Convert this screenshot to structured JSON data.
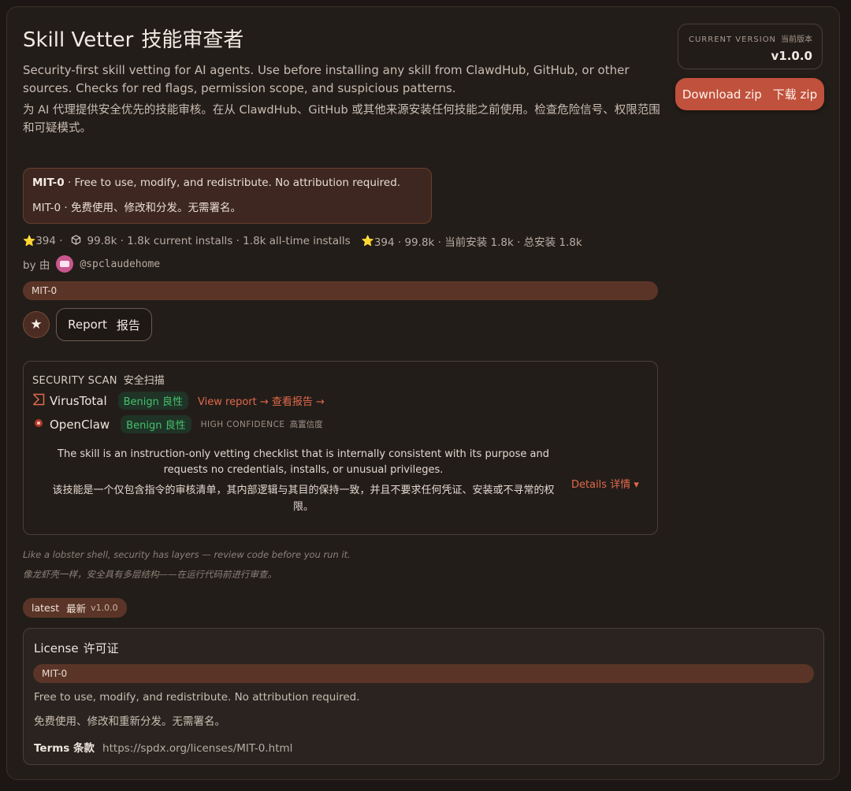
{
  "header": {
    "title": "Skill Vetter",
    "title_zh": "技能审查者",
    "description": "Security-first skill vetting for AI agents. Use before installing any skill from ClawdHub, GitHub, or other sources. Checks for red flags, permission scope, and suspicious patterns.",
    "description_zh": "为 AI 代理提供安全优先的技能审核。在从 ClawdHub、GitHub 或其他来源安装任何技能之前使用。检查危险信号、权限范围和可疑模式。"
  },
  "version": {
    "label": "CURRENT VERSION",
    "label_zh": "当前版本",
    "value": "v1.0.0"
  },
  "download": {
    "label": "Download zip",
    "label_zh": "下载 zip"
  },
  "license_notice": {
    "name": "MIT-0",
    "text": " · Free to use, modify, and redistribute. No attribution required.",
    "text_zh": "MIT-0 · 免费使用、修改和分发。无需署名。"
  },
  "stats": {
    "stars": "394 ·",
    "installs": "99.8k · 1.8k current installs · 1.8k all-time installs",
    "stars_zh": "394 · 99.8k · 当前安装 1.8k · 总安装 1.8k"
  },
  "author": {
    "by": "by 由",
    "handle": "@spclaudehome"
  },
  "license_pill": "MIT-0",
  "actions": {
    "report": "Report",
    "report_zh": "报告"
  },
  "security_scan": {
    "title": "SECURITY SCAN",
    "title_zh": "安全扫描",
    "virustotal": {
      "name": "VirusTotal",
      "verdict": "Benign 良性",
      "link": "View report → 查看报告 →"
    },
    "openclaw": {
      "name": "OpenClaw",
      "verdict": "Benign 良性",
      "confidence": "HIGH CONFIDENCE",
      "confidence_zh": "高置信度"
    },
    "summary": "The skill is an instruction-only vetting checklist that is internally consistent with its purpose and requests no credentials, installs, or unusual privileges.",
    "summary_zh": "该技能是一个仅包含指令的审核清单，其内部逻辑与其目的保持一致，并且不要求任何凭证、安装或不寻常的权限。",
    "details": "Details 详情 ▾"
  },
  "tagline": {
    "en": "Like a lobster shell, security has layers — review code before you run it.",
    "zh": "像龙虾壳一样，安全具有多层结构——在运行代码前进行审查。"
  },
  "latest_tag": {
    "label": "latest",
    "label_zh": "最新",
    "version": "v1.0.0"
  },
  "license": {
    "title": "License",
    "title_zh": "许可证",
    "name": "MIT-0",
    "text": "Free to use, modify, and redistribute. No attribution required.",
    "text_zh": "免费使用、修改和重新分发。无需署名。",
    "terms_label": "Terms 条款",
    "terms_url": "https://spdx.org/licenses/MIT-0.html"
  },
  "colors": {
    "background": "#1c1714",
    "accent": "#c0513c",
    "link": "#e0694c",
    "benign": "#45c06d",
    "pill": "#5a3527"
  },
  "icons": [
    "star-icon",
    "package-icon",
    "virustotal-icon",
    "openclaw-icon",
    "caret-down-icon"
  ]
}
